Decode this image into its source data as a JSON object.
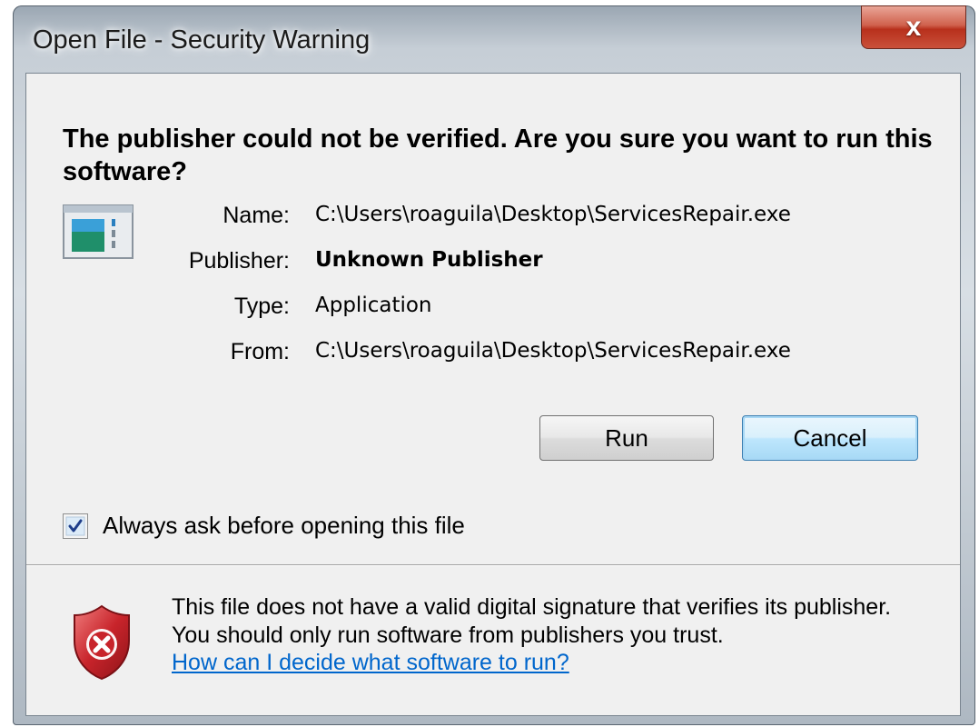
{
  "window": {
    "title": "Open File - Security Warning",
    "close_glyph": "x"
  },
  "prompt": {
    "heading": "The publisher could not be verified.  Are you sure you want to run this software?"
  },
  "file_info": {
    "icon": "application-icon",
    "rows": [
      {
        "label": "Name:",
        "value": "C:\\Users\\roaguila\\Desktop\\ServicesRepair.exe",
        "bold": false
      },
      {
        "label": "Publisher:",
        "value": "Unknown Publisher",
        "bold": true
      },
      {
        "label": "Type:",
        "value": "Application",
        "bold": false
      },
      {
        "label": "From:",
        "value": "C:\\Users\\roaguila\\Desktop\\ServicesRepair.exe",
        "bold": false
      }
    ]
  },
  "buttons": {
    "run_label": "Run",
    "cancel_label": "Cancel"
  },
  "always_ask": {
    "label": "Always ask before opening this file",
    "checked": true
  },
  "warning": {
    "icon": "shield-error-icon",
    "text": "This file does not have a valid digital signature that verifies its publisher.  You should only run software from publishers you trust.",
    "link_text": "How can I decide what software to run?"
  },
  "colors": {
    "link": "#0066cc",
    "close_button": "#c9503a",
    "shield_red": "#c8242b"
  }
}
